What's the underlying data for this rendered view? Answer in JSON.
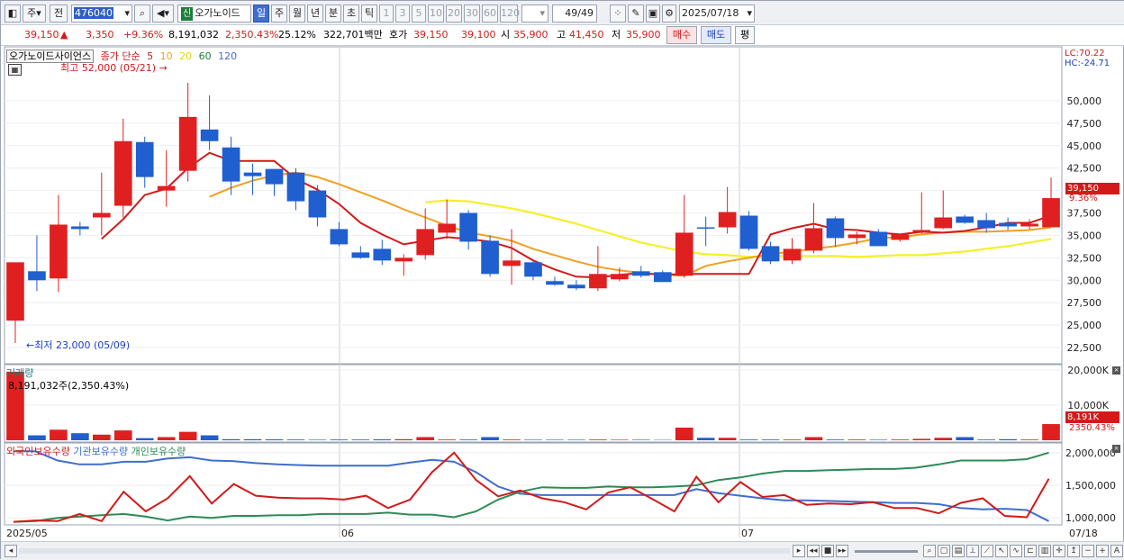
{
  "toolbar": {
    "type_selector": "주",
    "prev_label": "전",
    "code_value": "476040",
    "stock_name": "오가노이드",
    "sin_badge": "신",
    "period_tabs": [
      "일",
      "주",
      "월",
      "년",
      "분",
      "초",
      "틱"
    ],
    "active_period": "일",
    "interval_buttons": [
      "1",
      "3",
      "5",
      "10",
      "20",
      "30",
      "60",
      "120"
    ],
    "count_display": "49/49",
    "date_value": "2025/07/18"
  },
  "quote": {
    "price": "39,150",
    "arrow": "▲",
    "change": "3,350",
    "change_pct": "+9.36%",
    "volume": "8,191,032",
    "volume_ratio": "2,350.43%",
    "turnover": "25.12%",
    "amount": "322,701백만",
    "ask_label": "호가",
    "ask": "39,150",
    "bid": "39,100",
    "open_label": "시",
    "open": "35,900",
    "high_label": "고",
    "high": "41,450",
    "low_label": "저",
    "low": "35,900",
    "buy_button": "매수",
    "sell_button": "매도",
    "eval_button": "평"
  },
  "price_panel": {
    "stock_label": "오가노이드사이언스",
    "legend_prefix": "종가 단순",
    "ma_periods": [
      "5",
      "10",
      "20",
      "60",
      "120"
    ],
    "ma_colors": [
      "#d21a1a",
      "#f0a020",
      "#e9e300",
      "#1d7d3b",
      "#3f6ecf"
    ],
    "lc_text": "LC:70.22",
    "hc_text": "HC:-24.71",
    "high_note": "최고 52,000 (05/21)",
    "low_note": "최저 23,000 (05/09)",
    "current_tag": "39,150",
    "current_pct_tag": "9.36%",
    "y_ticks": [
      "50,000",
      "47,500",
      "45,000",
      "42,500",
      "40,000",
      "37,500",
      "35,000",
      "32,500",
      "30,000",
      "27,500",
      "25,000",
      "22,500"
    ]
  },
  "volume_panel": {
    "title": "거래량",
    "detail": "8,191,032주(2,350.43%)",
    "y_ticks": [
      "20,000K",
      "10,000K"
    ],
    "current_tag": "8,191K",
    "current_pct_tag": "2350.43%"
  },
  "holdings_panel": {
    "series_labels": [
      "외국인보유수량",
      "기관보유수량",
      "개인보유수량"
    ],
    "series_colors": [
      "#d21a1a",
      "#3f6ecf",
      "#2e8b57"
    ],
    "y_ticks": [
      "2,000,000",
      "1,500,000",
      "1,000,000"
    ]
  },
  "x_axis": {
    "labels": [
      "2025/05",
      "06",
      "07",
      "07/18"
    ]
  },
  "chart_data": {
    "type": "candlestick",
    "price_unit": "KRW",
    "ylim": [
      21500,
      52500
    ],
    "candles": [
      {
        "o": 25500,
        "h": 29500,
        "l": 23000,
        "c": 32000
      },
      {
        "o": 31000,
        "h": 35000,
        "l": 28800,
        "c": 30000
      },
      {
        "o": 30200,
        "h": 39500,
        "l": 28700,
        "c": 36200
      },
      {
        "o": 36000,
        "h": 36500,
        "l": 35000,
        "c": 35700
      },
      {
        "o": 37000,
        "h": 42000,
        "l": 35000,
        "c": 37500
      },
      {
        "o": 38300,
        "h": 48000,
        "l": 37000,
        "c": 45500
      },
      {
        "o": 45400,
        "h": 46000,
        "l": 40300,
        "c": 41500
      },
      {
        "o": 40000,
        "h": 44500,
        "l": 38200,
        "c": 40500
      },
      {
        "o": 42200,
        "h": 52000,
        "l": 41000,
        "c": 48200
      },
      {
        "o": 46800,
        "h": 50600,
        "l": 44500,
        "c": 45500
      },
      {
        "o": 44800,
        "h": 46000,
        "l": 39500,
        "c": 41000
      },
      {
        "o": 42000,
        "h": 43000,
        "l": 39500,
        "c": 41600
      },
      {
        "o": 42400,
        "h": 42400,
        "l": 39400,
        "c": 40700
      },
      {
        "o": 42000,
        "h": 42500,
        "l": 37800,
        "c": 38800
      },
      {
        "o": 40000,
        "h": 40600,
        "l": 36000,
        "c": 37000
      },
      {
        "o": 35700,
        "h": 36500,
        "l": 33800,
        "c": 34000
      },
      {
        "o": 33100,
        "h": 33800,
        "l": 32400,
        "c": 32500
      },
      {
        "o": 33500,
        "h": 34500,
        "l": 31700,
        "c": 32200
      },
      {
        "o": 32100,
        "h": 32900,
        "l": 30500,
        "c": 32500
      },
      {
        "o": 32800,
        "h": 38000,
        "l": 32300,
        "c": 35700
      },
      {
        "o": 35300,
        "h": 39000,
        "l": 34600,
        "c": 36300
      },
      {
        "o": 37500,
        "h": 37800,
        "l": 33400,
        "c": 34300
      },
      {
        "o": 34400,
        "h": 35000,
        "l": 30400,
        "c": 30700
      },
      {
        "o": 31600,
        "h": 35700,
        "l": 29500,
        "c": 32200
      },
      {
        "o": 32000,
        "h": 32200,
        "l": 30000,
        "c": 30400
      },
      {
        "o": 29900,
        "h": 30400,
        "l": 29400,
        "c": 29500
      },
      {
        "o": 29500,
        "h": 30000,
        "l": 28900,
        "c": 29100
      },
      {
        "o": 29100,
        "h": 33800,
        "l": 28800,
        "c": 30700
      },
      {
        "o": 30100,
        "h": 31400,
        "l": 29900,
        "c": 30700
      },
      {
        "o": 31000,
        "h": 31600,
        "l": 30300,
        "c": 30500
      },
      {
        "o": 30900,
        "h": 31100,
        "l": 29800,
        "c": 29800
      },
      {
        "o": 30500,
        "h": 39500,
        "l": 30300,
        "c": 35300
      },
      {
        "o": 35900,
        "h": 37100,
        "l": 33800,
        "c": 35800
      },
      {
        "o": 35900,
        "h": 40400,
        "l": 35200,
        "c": 37600
      },
      {
        "o": 37200,
        "h": 37700,
        "l": 33300,
        "c": 33500
      },
      {
        "o": 33800,
        "h": 34300,
        "l": 31800,
        "c": 32100
      },
      {
        "o": 32200,
        "h": 34700,
        "l": 31800,
        "c": 33500
      },
      {
        "o": 33300,
        "h": 38600,
        "l": 33000,
        "c": 35800
      },
      {
        "o": 36900,
        "h": 37100,
        "l": 33700,
        "c": 34700
      },
      {
        "o": 34700,
        "h": 35400,
        "l": 34000,
        "c": 35100
      },
      {
        "o": 35400,
        "h": 35700,
        "l": 33800,
        "c": 33800
      },
      {
        "o": 34500,
        "h": 35100,
        "l": 34300,
        "c": 35100
      },
      {
        "o": 35400,
        "h": 39800,
        "l": 35200,
        "c": 35600
      },
      {
        "o": 35800,
        "h": 40000,
        "l": 35700,
        "c": 37000
      },
      {
        "o": 37100,
        "h": 37300,
        "l": 36300,
        "c": 36400
      },
      {
        "o": 36700,
        "h": 37500,
        "l": 35300,
        "c": 35800
      },
      {
        "o": 36400,
        "h": 37000,
        "l": 35600,
        "c": 36000
      },
      {
        "o": 36000,
        "h": 36800,
        "l": 35700,
        "c": 36300
      },
      {
        "o": 35900,
        "h": 41450,
        "l": 35900,
        "c": 39150
      }
    ],
    "ma5": [
      null,
      null,
      null,
      null,
      34600,
      36800,
      39500,
      40200,
      42500,
      44200,
      43300,
      43300,
      43300,
      41300,
      40100,
      38500,
      36400,
      35100,
      34000,
      34400,
      34800,
      34600,
      34300,
      33600,
      32200,
      31200,
      30400,
      30300,
      30600,
      30800,
      30600,
      30700,
      30700,
      30700,
      30700,
      35100,
      35800,
      36300,
      35700,
      35600,
      35300,
      35100,
      35400,
      35300,
      35500,
      35900,
      36400,
      36400,
      37200
    ],
    "ma10": [
      null,
      null,
      null,
      null,
      null,
      null,
      null,
      null,
      null,
      39300,
      40300,
      41100,
      41700,
      42000,
      41500,
      40700,
      39800,
      38900,
      37900,
      37000,
      36100,
      35300,
      34900,
      34400,
      33500,
      32800,
      32100,
      31500,
      31100,
      30800,
      30600,
      30500,
      31600,
      32100,
      32500,
      32900,
      33200,
      33500,
      33800,
      34200,
      34700,
      34800,
      35100,
      35300,
      35400,
      35400,
      35500,
      35600,
      35900
    ],
    "ma20": [
      null,
      null,
      null,
      null,
      null,
      null,
      null,
      null,
      null,
      null,
      null,
      null,
      null,
      null,
      null,
      null,
      null,
      null,
      null,
      38700,
      38900,
      38800,
      38400,
      38000,
      37500,
      36900,
      36300,
      35600,
      34900,
      34200,
      33700,
      33200,
      32900,
      32800,
      32600,
      32700,
      32700,
      32700,
      32700,
      32600,
      32700,
      32800,
      32800,
      33000,
      33200,
      33500,
      33800,
      34200,
      34600
    ],
    "volume_k": [
      19500,
      1400,
      3000,
      2000,
      1600,
      2800,
      600,
      900,
      2400,
      1400,
      300,
      300,
      250,
      200,
      150,
      200,
      200,
      250,
      300,
      900,
      200,
      200,
      900,
      200,
      150,
      150,
      150,
      200,
      150,
      150,
      100,
      3600,
      700,
      700,
      200,
      200,
      200,
      900,
      200,
      200,
      150,
      200,
      400,
      700,
      900,
      200,
      300,
      200,
      4600
    ],
    "holdings": {
      "foreign": [
        940000,
        960000,
        950000,
        1060000,
        950000,
        1400000,
        1100000,
        1300000,
        1640000,
        1220000,
        1520000,
        1340000,
        1310000,
        1300000,
        1300000,
        1280000,
        1340000,
        1150000,
        1280000,
        1700000,
        2000000,
        1580000,
        1330000,
        1420000,
        1300000,
        1240000,
        1130000,
        1390000,
        1470000,
        1290000,
        1100000,
        1630000,
        1240000,
        1550000,
        1320000,
        1350000,
        1200000,
        1220000,
        1210000,
        1240000,
        1150000,
        1150000,
        1070000,
        1230000,
        1300000,
        1030000,
        1010000,
        1600000
      ],
      "institution": [
        2020000,
        2020000,
        1880000,
        1820000,
        1820000,
        1860000,
        1860000,
        1910000,
        1930000,
        1880000,
        1870000,
        1840000,
        1820000,
        1810000,
        1800000,
        1800000,
        1800000,
        1800000,
        1850000,
        1890000,
        1860000,
        1700000,
        1480000,
        1370000,
        1350000,
        1350000,
        1350000,
        1350000,
        1350000,
        1350000,
        1350000,
        1440000,
        1380000,
        1340000,
        1300000,
        1270000,
        1270000,
        1260000,
        1250000,
        1240000,
        1230000,
        1230000,
        1210000,
        1150000,
        1130000,
        1140000,
        1120000,
        950000
      ],
      "individual": [
        940000,
        950000,
        1000000,
        1020000,
        1040000,
        1060000,
        1020000,
        960000,
        1020000,
        1000000,
        1030000,
        1030000,
        1040000,
        1040000,
        1060000,
        1060000,
        1060000,
        1080000,
        1050000,
        1050000,
        1010000,
        1100000,
        1280000,
        1400000,
        1470000,
        1460000,
        1460000,
        1480000,
        1470000,
        1470000,
        1480000,
        1500000,
        1580000,
        1620000,
        1680000,
        1720000,
        1720000,
        1730000,
        1740000,
        1750000,
        1750000,
        1770000,
        1820000,
        1880000,
        1880000,
        1880000,
        1900000,
        2000000
      ]
    }
  }
}
